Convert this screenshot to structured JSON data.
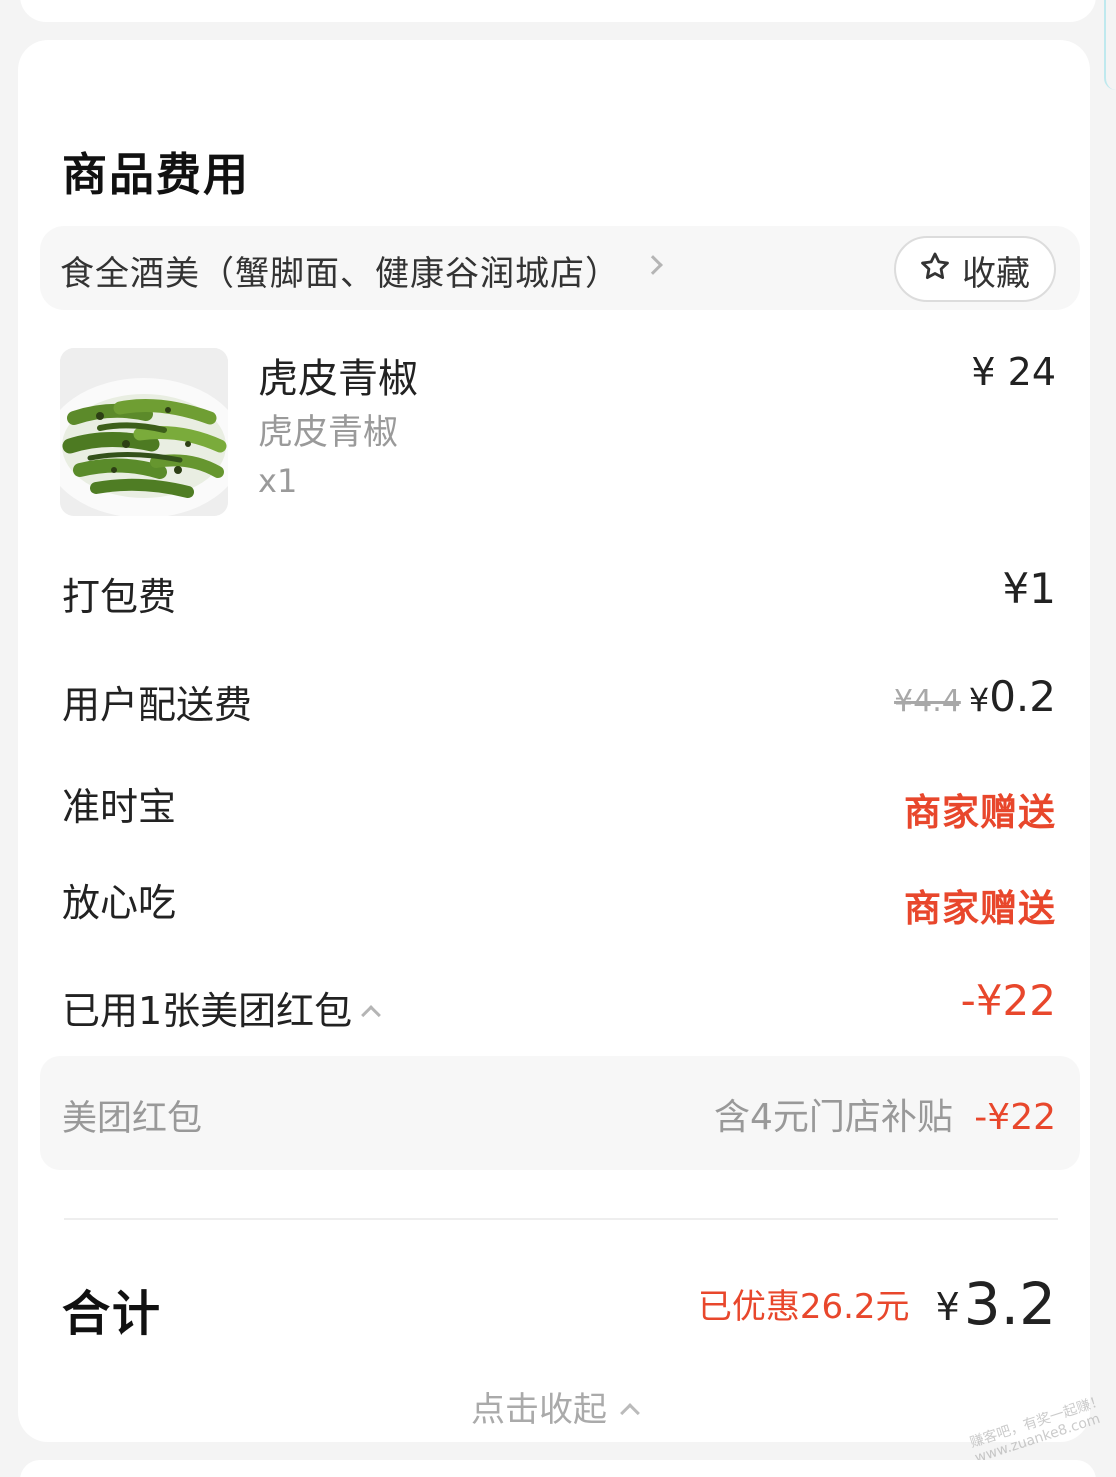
{
  "section": {
    "title": "商品费用"
  },
  "store": {
    "name": "食全酒美（蟹脚面、健康谷润城店）",
    "favorite_label": "收藏"
  },
  "item": {
    "name": "虎皮青椒",
    "spec": "虎皮青椒",
    "quantity": "x1",
    "price": "¥ 24"
  },
  "fees": {
    "packing": {
      "label": "打包费",
      "value": "¥1"
    },
    "delivery": {
      "label": "用户配送费",
      "original": "¥4.4",
      "yen": "¥",
      "value": "0.2"
    },
    "ontime": {
      "label": "准时宝",
      "value": "商家赠送"
    },
    "assured": {
      "label": "放心吃",
      "value": "商家赠送"
    },
    "redpacket": {
      "label": "已用1张美团红包",
      "value": "-¥22"
    }
  },
  "coupon": {
    "label": "美团红包",
    "note": "含4元门店补贴",
    "value": "-¥22"
  },
  "total": {
    "label": "合计",
    "saved": "已优惠26.2元",
    "yen": "¥",
    "value": "3.2"
  },
  "collapse": {
    "label": "点击收起"
  },
  "watermark": {
    "line1": "赚客吧，有奖一起赚！",
    "line2": "www.zuanke8.com"
  },
  "colors": {
    "accent_red": "#e8472c",
    "muted": "#9a9a9a"
  },
  "icons": [
    "star-outline-icon",
    "chevron-right-icon",
    "chevron-up-icon"
  ]
}
